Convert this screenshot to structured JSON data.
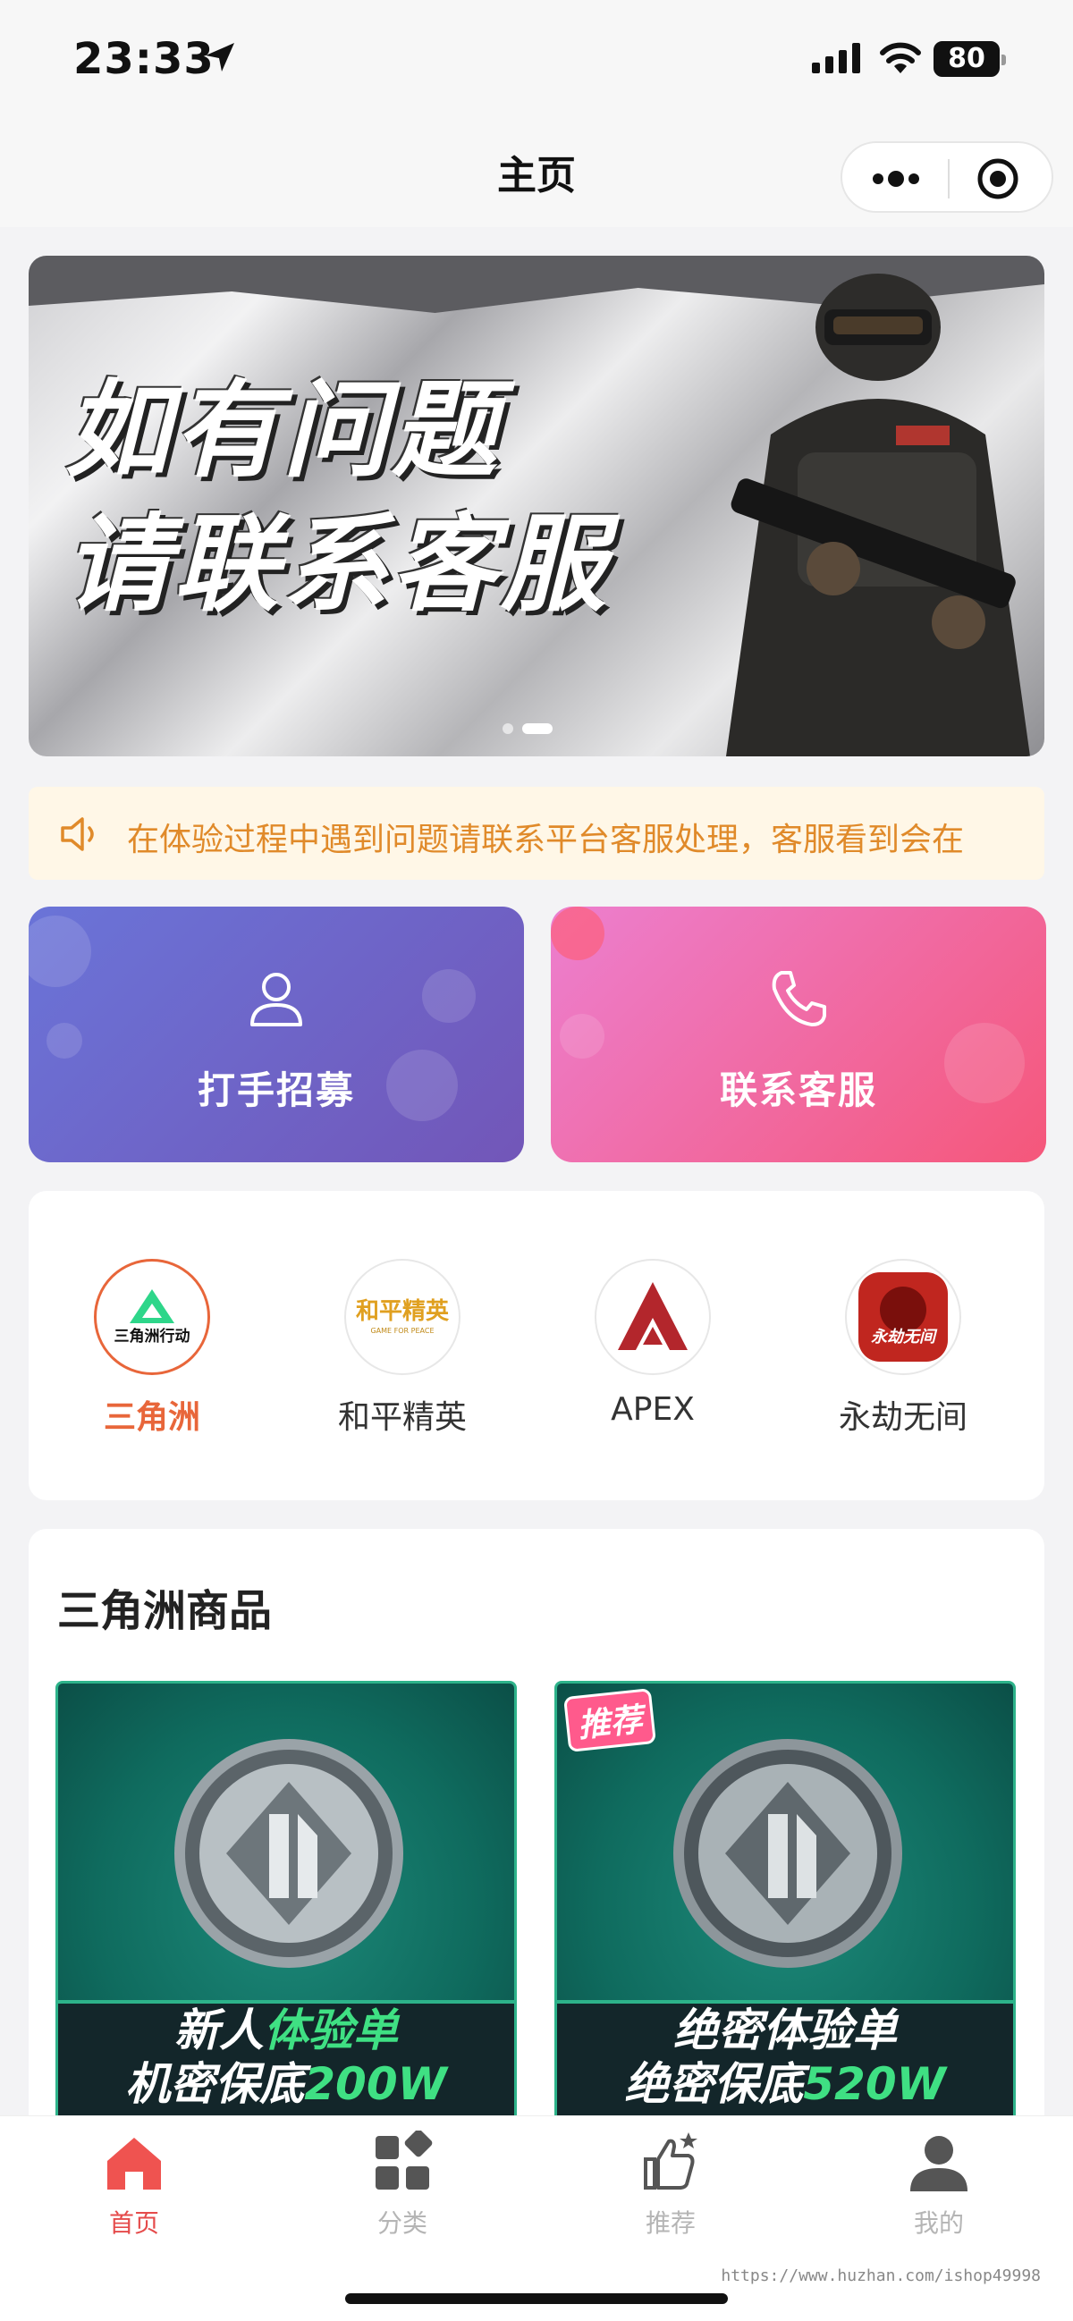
{
  "status_bar": {
    "time": "23:33",
    "battery": "80"
  },
  "nav": {
    "title": "主页"
  },
  "banner": {
    "line1": "如有问题",
    "line2": "请联系客服"
  },
  "notice": {
    "text": "在体验过程中遇到问题请联系平台客服处理，客服看到会在"
  },
  "actions": [
    {
      "label": "打手招募",
      "icon": "user-icon"
    },
    {
      "label": "联系客服",
      "icon": "phone-icon"
    }
  ],
  "games": [
    {
      "name": "三角洲",
      "logo_text": "三角洲行动",
      "active": true
    },
    {
      "name": "和平精英",
      "logo_text": "和平精英",
      "logo_sub": "GAME FOR PEACE",
      "active": false
    },
    {
      "name": "APEX",
      "active": false
    },
    {
      "name": "永劫无间",
      "logo_text": "永劫无间",
      "active": false
    }
  ],
  "products": {
    "title": "三角洲商品",
    "items": [
      {
        "line1_a": "新人",
        "line1_b": "体验单",
        "line2_a": "机密保底",
        "line2_b": "200W"
      },
      {
        "badge": "推荐",
        "line1_a": "绝密体验单",
        "line1_b": "",
        "line2_a": "绝密保底",
        "line2_b": "520W"
      }
    ]
  },
  "tabbar": {
    "items": [
      {
        "label": "首页",
        "icon": "home-icon",
        "active": true
      },
      {
        "label": "分类",
        "icon": "category-icon",
        "active": false
      },
      {
        "label": "推荐",
        "icon": "thumbs-up-icon",
        "active": false
      },
      {
        "label": "我的",
        "icon": "profile-icon",
        "active": false
      }
    ]
  },
  "watermark": "https://www.huzhan.com/ishop49998",
  "colors": {
    "accent": "#e8663a",
    "tab_active": "#e54b4b",
    "notice_text": "#e08a2a",
    "product_green": "#3fe083"
  }
}
